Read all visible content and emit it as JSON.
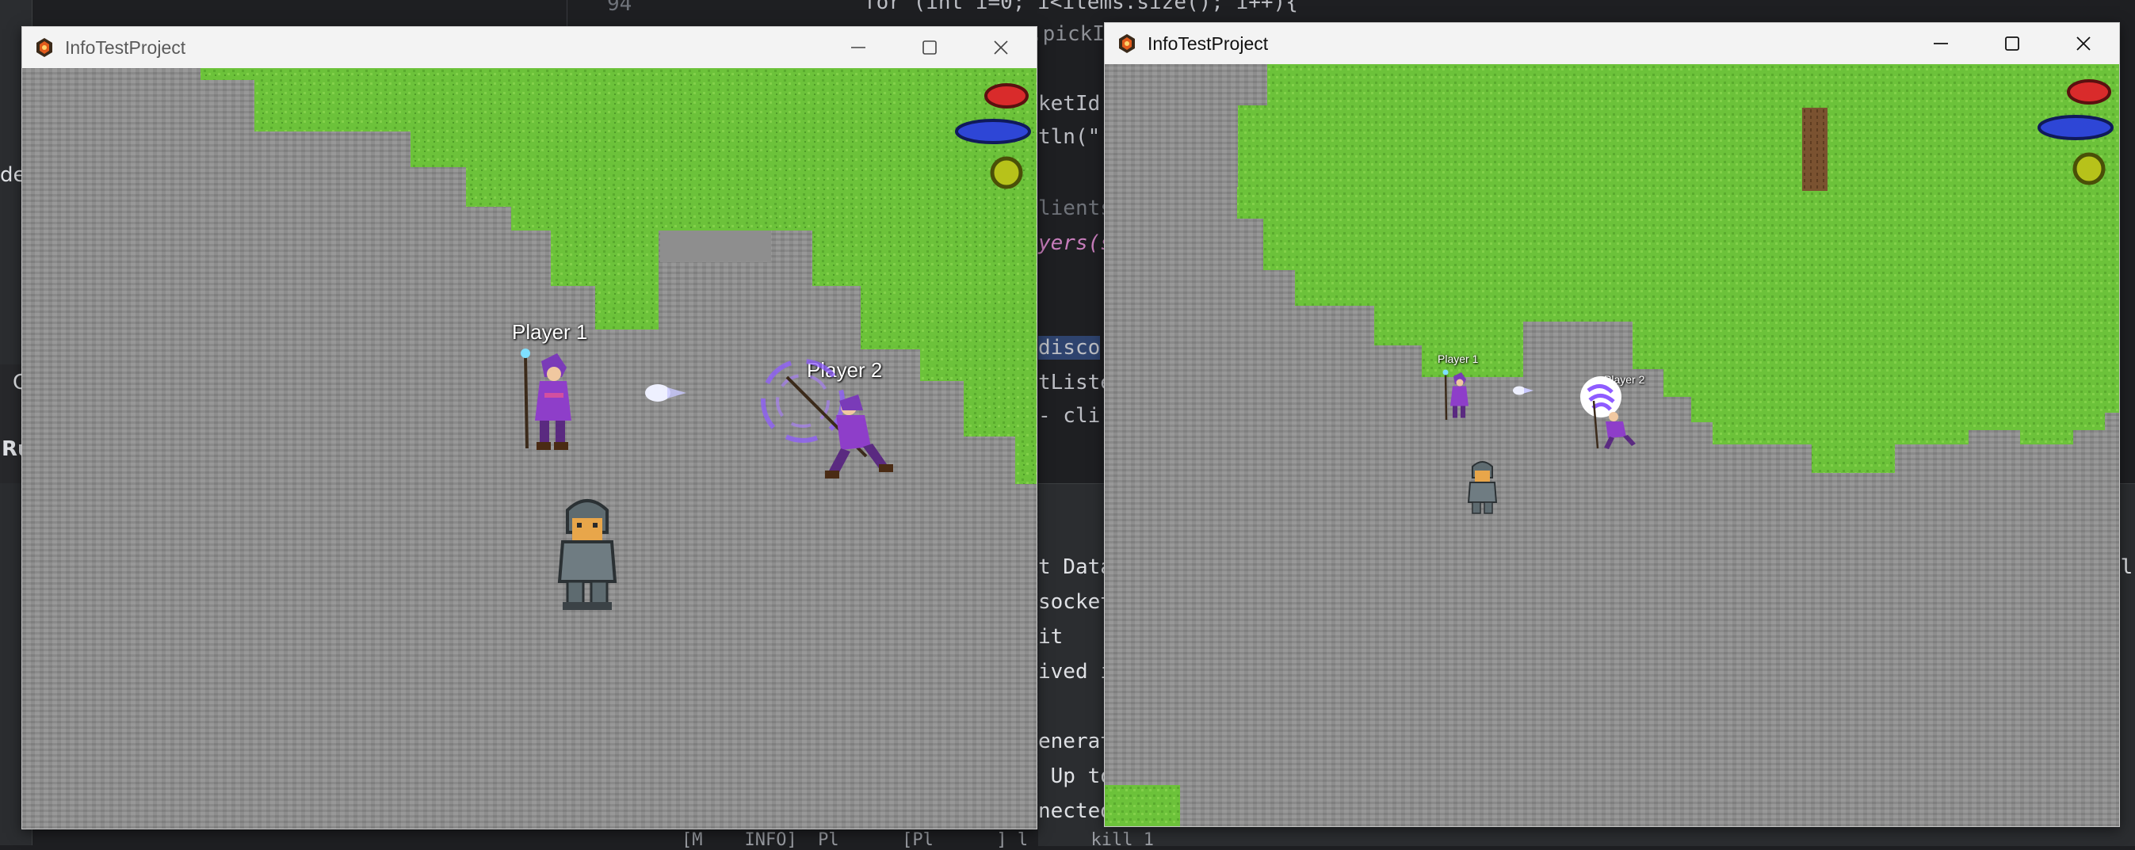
{
  "ide": {
    "code_lines": [
      "for (int i=0; i<items.size(); i++){",
      ".pickI",
      "ketId,",
      "tln(\"[",
      "lients",
      "yers(s",
      "disco",
      "tListe",
      "- cli"
    ],
    "side_labels": [
      "C",
      "Ru",
      "de"
    ],
    "console_lines": [
      "t Data",
      "socket",
      "it",
      "ived i",
      "enerat",
      " Up to",
      "nected",
      "[M    INFO]  Pl      [Pl      ] l      kill 1"
    ],
    "line_number": "94",
    "right_edge_label": "ll"
  },
  "windows": [
    {
      "title": "InfoTestProject",
      "players": [
        "Player 1",
        "Player 2"
      ],
      "hud": {
        "health_color": "#d92b2b",
        "mana_color": "#2e46d6",
        "stamina_color": "#b7c21a"
      }
    },
    {
      "title": "InfoTestProject",
      "players": [
        "Player 1",
        "Player 2"
      ],
      "hud": {
        "health_color": "#d92b2b",
        "mana_color": "#2e46d6",
        "stamina_color": "#b7c21a"
      }
    }
  ],
  "controls": {
    "minimize": "minimize-icon",
    "maximize": "maximize-icon",
    "close": "close-icon"
  },
  "colors": {
    "grass": "#6cc23a",
    "stone": "#8e8e8e",
    "tree_trunk": "#7a5230"
  }
}
